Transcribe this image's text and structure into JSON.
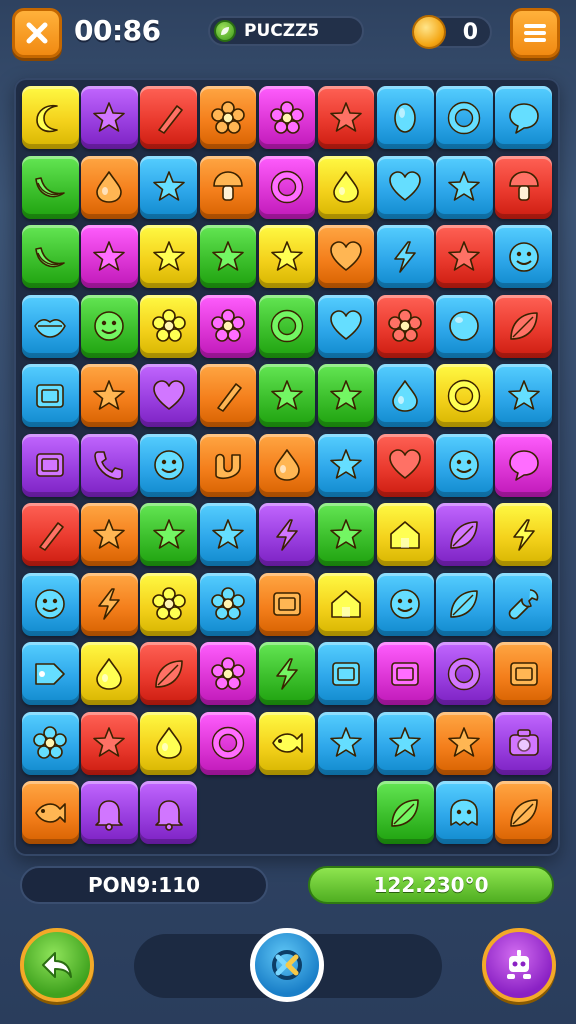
{
  "header": {
    "timer": "00:86",
    "title": "PUCZZ5",
    "coins": "0",
    "close_icon": "close-x-icon",
    "menu_icon": "hamburger-menu-icon",
    "title_icon": "leaf-badge-icon",
    "coin_icon": "gold-coin-icon"
  },
  "board": {
    "columns": 9,
    "rows": [
      [
        "yellow:crescent",
        "purple:star",
        "red:stick",
        "orange:flower",
        "magenta:flower",
        "red:star",
        "blue:gem",
        "blue:ring",
        "blue:chat"
      ],
      [
        "green:banana",
        "orange:drop",
        "blue:star",
        "orange:mushroom",
        "magenta:ring",
        "yellow:drop",
        "blue:heart",
        "blue:star",
        "red:mushroom"
      ],
      [
        "green:banana",
        "magenta:star",
        "yellow:star",
        "green:star",
        "yellow:star",
        "orange:heart",
        "blue:bolt",
        "red:star",
        "blue:face"
      ],
      [
        "blue:lips",
        "green:face",
        "yellow:flower",
        "magenta:flower",
        "green:ring",
        "blue:heart",
        "red:flower",
        "blue:ball",
        "red:leaf"
      ],
      [
        "blue:box",
        "orange:star",
        "purple:heart",
        "orange:stick",
        "green:star",
        "green:star",
        "blue:drop",
        "yellow:ring",
        "blue:star"
      ],
      [
        "purple:box",
        "purple:phone",
        "blue:face",
        "orange:wave",
        "orange:drop",
        "blue:star",
        "red:heart",
        "blue:face",
        "magenta:chat"
      ],
      [
        "red:stick",
        "orange:star",
        "green:star",
        "blue:star",
        "purple:bolt",
        "green:star",
        "yellow:house",
        "purple:leaf",
        "yellow:bolt"
      ],
      [
        "blue:face",
        "orange:bolt",
        "yellow:flower",
        "blue:flower",
        "orange:box",
        "yellow:house",
        "blue:face",
        "blue:leaf",
        "blue:wrench"
      ],
      [
        "blue:tag",
        "yellow:drop",
        "red:leaf",
        "magenta:flower",
        "green:bolt",
        "blue:box",
        "magenta:box",
        "purple:ring",
        "orange:box"
      ],
      [
        "blue:flower",
        "red:star",
        "yellow:drop",
        "magenta:ring",
        "yellow:fish",
        "blue:star",
        "blue:star",
        "orange:star",
        "purple:camera"
      ],
      [
        "orange:fish",
        "purple:bell",
        "purple:bell",
        "",
        "",
        "",
        "green:leaf",
        "blue:ghost",
        "orange:leaf"
      ]
    ],
    "colors": {
      "yellow": "#f4d21c",
      "purple": "#9a3fe0",
      "red": "#ea3a2e",
      "orange": "#f47f1c",
      "magenta": "#dd36d6",
      "blue": "#2ea7ea",
      "green": "#3cbf2c"
    }
  },
  "scores": {
    "left": "PON9:110",
    "right": "122.230°0"
  },
  "controls": {
    "back_icon": "undo-arrow-icon",
    "center_icon": "shuffle-swap-icon",
    "settings_icon": "settings-robot-icon"
  }
}
